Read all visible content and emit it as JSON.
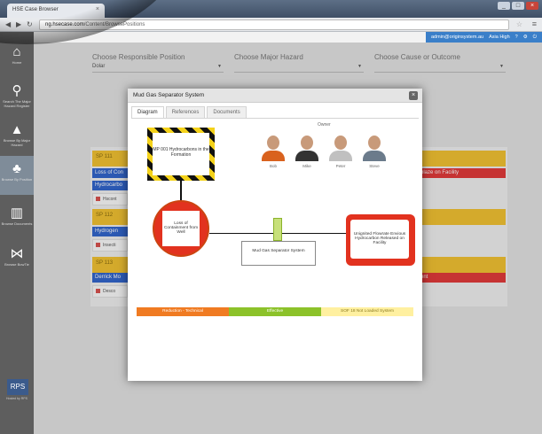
{
  "browser": {
    "tab_title": "HSE Case Browser",
    "tab_close": "×",
    "url_prefix": "",
    "url_domain": "ng.hsecase.com",
    "url_path": "/Content/BrowsePositions",
    "star_icon": "star-icon",
    "menu_icon": "menu-icon",
    "win_min": "_",
    "win_max": "□",
    "win_close": "×"
  },
  "sidebar": {
    "items": [
      {
        "icon": "home-icon",
        "glyph": "⌂",
        "label": "Home"
      },
      {
        "icon": "search-icon",
        "glyph": "⚲",
        "label": "Search The Major Hazard Register"
      },
      {
        "icon": "warning-icon",
        "glyph": "▲",
        "label": "Browse By Major Hazard"
      },
      {
        "icon": "people-icon",
        "glyph": "♣",
        "label": "Browse By Position"
      },
      {
        "icon": "book-icon",
        "glyph": "▥",
        "label": "Browse Documents"
      },
      {
        "icon": "bowtie-icon",
        "glyph": "⋈",
        "label": "Browse BowTie"
      }
    ],
    "logo": "RPS",
    "powered_by": "Hosted by RPS"
  },
  "appbar": {
    "user": "admin@originsystem.au",
    "risk": "Asia High",
    "help_icon": "?",
    "settings_icon": "⚙",
    "signout_icon": "⏻"
  },
  "filters": {
    "responsible_label": "Choose Responsible Position",
    "responsible_value": "Dolar",
    "hazard_label": "Choose Major Hazard",
    "hazard_value": "",
    "cause_label": "Choose Cause or Outcome",
    "cause_value": ""
  },
  "cards": [
    {
      "head": "SP 111",
      "blue": "Loss of Con",
      "blue2": "Hydrocarbo",
      "row": "Hscont",
      "red": "blaze on Facility"
    },
    {
      "head": "SP 112",
      "blue": "Hydrogen",
      "row": "Insecti",
      "red": ""
    },
    {
      "head": "SP 113",
      "blue": "Derrick Mo",
      "row": "Desco",
      "red": "ent"
    }
  ],
  "modal": {
    "title": "Mud Gas Separator System",
    "close": "×",
    "tabs": [
      "Diagram",
      "References",
      "Documents"
    ],
    "hazard_text": "MP 001 Hydrocarbons in the Formation",
    "top_event_text": "Loss of Containment from Well",
    "barrier_text": "Mud Gas Separator System",
    "consequence_text": "Unignited Flowrate Envious Hydrocarbon Released on Facility",
    "owners_label": "Owner",
    "owners": [
      {
        "name": "Bob",
        "shirt": "#d9621e"
      },
      {
        "name": "Mike",
        "shirt": "#333333"
      },
      {
        "name": "Peter",
        "shirt": "#c0c0c0"
      },
      {
        "name": "Steve",
        "shirt": "#6b7b8b"
      }
    ],
    "legend": [
      "Reduction - Technical",
      "Effective",
      "SOF 18 Not Loaded System"
    ]
  }
}
